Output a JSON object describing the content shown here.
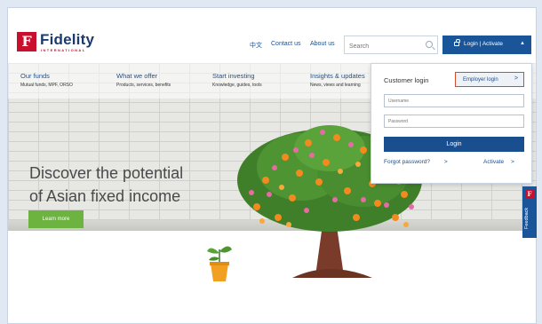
{
  "brand": {
    "logo_letter": "F",
    "name": "Fidelity",
    "tagline": "INTERNATIONAL",
    "color_red": "#c8102e",
    "color_navy": "#1d3a6e"
  },
  "header": {
    "lang": "中文",
    "contact": "Contact us",
    "about": "About us",
    "search_placeholder": "Search",
    "login_label": "Login | Activate",
    "login_caret": "▲"
  },
  "nav": [
    {
      "title": "Our funds",
      "sub": "Mutual funds, MPF, ORSO"
    },
    {
      "title": "What we offer",
      "sub": "Products, services, benefits"
    },
    {
      "title": "Start investing",
      "sub": "Knowledge, guides, tools"
    },
    {
      "title": "Insights & updates",
      "sub": "News, views and learning"
    }
  ],
  "hero": {
    "line1": "Discover the potential",
    "line2": "of Asian fixed income",
    "cta": "Learn more"
  },
  "login_panel": {
    "title": "Customer login",
    "employer_btn": "Employer login",
    "employer_arrow": ">",
    "username_placeholder": "Username",
    "password_placeholder": "Password",
    "submit": "Login",
    "forgot": "Forgot password?",
    "forgot_arrow": ">",
    "activate": "Activate",
    "activate_arrow": ">"
  },
  "feedback": {
    "icon": "F",
    "label": "Feedback"
  }
}
